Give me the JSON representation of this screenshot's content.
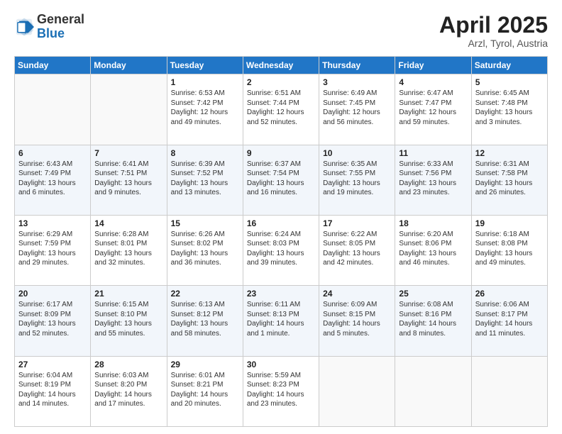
{
  "header": {
    "logo_general": "General",
    "logo_blue": "Blue",
    "title": "April 2025",
    "location": "Arzl, Tyrol, Austria"
  },
  "weekdays": [
    "Sunday",
    "Monday",
    "Tuesday",
    "Wednesday",
    "Thursday",
    "Friday",
    "Saturday"
  ],
  "weeks": [
    [
      {
        "day": "",
        "info": ""
      },
      {
        "day": "",
        "info": ""
      },
      {
        "day": "1",
        "info": "Sunrise: 6:53 AM\nSunset: 7:42 PM\nDaylight: 12 hours\nand 49 minutes."
      },
      {
        "day": "2",
        "info": "Sunrise: 6:51 AM\nSunset: 7:44 PM\nDaylight: 12 hours\nand 52 minutes."
      },
      {
        "day": "3",
        "info": "Sunrise: 6:49 AM\nSunset: 7:45 PM\nDaylight: 12 hours\nand 56 minutes."
      },
      {
        "day": "4",
        "info": "Sunrise: 6:47 AM\nSunset: 7:47 PM\nDaylight: 12 hours\nand 59 minutes."
      },
      {
        "day": "5",
        "info": "Sunrise: 6:45 AM\nSunset: 7:48 PM\nDaylight: 13 hours\nand 3 minutes."
      }
    ],
    [
      {
        "day": "6",
        "info": "Sunrise: 6:43 AM\nSunset: 7:49 PM\nDaylight: 13 hours\nand 6 minutes."
      },
      {
        "day": "7",
        "info": "Sunrise: 6:41 AM\nSunset: 7:51 PM\nDaylight: 13 hours\nand 9 minutes."
      },
      {
        "day": "8",
        "info": "Sunrise: 6:39 AM\nSunset: 7:52 PM\nDaylight: 13 hours\nand 13 minutes."
      },
      {
        "day": "9",
        "info": "Sunrise: 6:37 AM\nSunset: 7:54 PM\nDaylight: 13 hours\nand 16 minutes."
      },
      {
        "day": "10",
        "info": "Sunrise: 6:35 AM\nSunset: 7:55 PM\nDaylight: 13 hours\nand 19 minutes."
      },
      {
        "day": "11",
        "info": "Sunrise: 6:33 AM\nSunset: 7:56 PM\nDaylight: 13 hours\nand 23 minutes."
      },
      {
        "day": "12",
        "info": "Sunrise: 6:31 AM\nSunset: 7:58 PM\nDaylight: 13 hours\nand 26 minutes."
      }
    ],
    [
      {
        "day": "13",
        "info": "Sunrise: 6:29 AM\nSunset: 7:59 PM\nDaylight: 13 hours\nand 29 minutes."
      },
      {
        "day": "14",
        "info": "Sunrise: 6:28 AM\nSunset: 8:01 PM\nDaylight: 13 hours\nand 32 minutes."
      },
      {
        "day": "15",
        "info": "Sunrise: 6:26 AM\nSunset: 8:02 PM\nDaylight: 13 hours\nand 36 minutes."
      },
      {
        "day": "16",
        "info": "Sunrise: 6:24 AM\nSunset: 8:03 PM\nDaylight: 13 hours\nand 39 minutes."
      },
      {
        "day": "17",
        "info": "Sunrise: 6:22 AM\nSunset: 8:05 PM\nDaylight: 13 hours\nand 42 minutes."
      },
      {
        "day": "18",
        "info": "Sunrise: 6:20 AM\nSunset: 8:06 PM\nDaylight: 13 hours\nand 46 minutes."
      },
      {
        "day": "19",
        "info": "Sunrise: 6:18 AM\nSunset: 8:08 PM\nDaylight: 13 hours\nand 49 minutes."
      }
    ],
    [
      {
        "day": "20",
        "info": "Sunrise: 6:17 AM\nSunset: 8:09 PM\nDaylight: 13 hours\nand 52 minutes."
      },
      {
        "day": "21",
        "info": "Sunrise: 6:15 AM\nSunset: 8:10 PM\nDaylight: 13 hours\nand 55 minutes."
      },
      {
        "day": "22",
        "info": "Sunrise: 6:13 AM\nSunset: 8:12 PM\nDaylight: 13 hours\nand 58 minutes."
      },
      {
        "day": "23",
        "info": "Sunrise: 6:11 AM\nSunset: 8:13 PM\nDaylight: 14 hours\nand 1 minute."
      },
      {
        "day": "24",
        "info": "Sunrise: 6:09 AM\nSunset: 8:15 PM\nDaylight: 14 hours\nand 5 minutes."
      },
      {
        "day": "25",
        "info": "Sunrise: 6:08 AM\nSunset: 8:16 PM\nDaylight: 14 hours\nand 8 minutes."
      },
      {
        "day": "26",
        "info": "Sunrise: 6:06 AM\nSunset: 8:17 PM\nDaylight: 14 hours\nand 11 minutes."
      }
    ],
    [
      {
        "day": "27",
        "info": "Sunrise: 6:04 AM\nSunset: 8:19 PM\nDaylight: 14 hours\nand 14 minutes."
      },
      {
        "day": "28",
        "info": "Sunrise: 6:03 AM\nSunset: 8:20 PM\nDaylight: 14 hours\nand 17 minutes."
      },
      {
        "day": "29",
        "info": "Sunrise: 6:01 AM\nSunset: 8:21 PM\nDaylight: 14 hours\nand 20 minutes."
      },
      {
        "day": "30",
        "info": "Sunrise: 5:59 AM\nSunset: 8:23 PM\nDaylight: 14 hours\nand 23 minutes."
      },
      {
        "day": "",
        "info": ""
      },
      {
        "day": "",
        "info": ""
      },
      {
        "day": "",
        "info": ""
      }
    ]
  ]
}
